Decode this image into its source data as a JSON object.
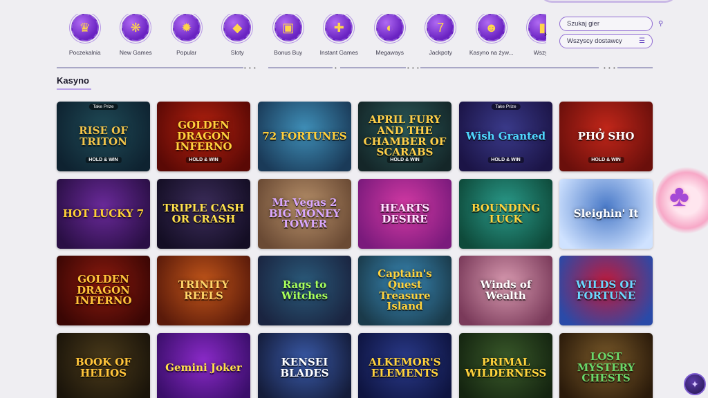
{
  "categories": [
    {
      "label": "Poczekalnia",
      "icon": "crown-icon",
      "glyph": "♛"
    },
    {
      "label": "New Games",
      "icon": "new-games-icon",
      "glyph": "❋"
    },
    {
      "label": "Popular",
      "icon": "flame-icon",
      "glyph": "✹"
    },
    {
      "label": "Sloty",
      "icon": "gem-icon",
      "glyph": "◆"
    },
    {
      "label": "Bonus Buy",
      "icon": "gift-icon",
      "glyph": "▣"
    },
    {
      "label": "Instant Games",
      "icon": "gamepad-icon",
      "glyph": "✚"
    },
    {
      "label": "Megaways",
      "icon": "megaways-icon",
      "glyph": "◐"
    },
    {
      "label": "Jackpoty",
      "icon": "jackpot-777-icon",
      "glyph": "7"
    },
    {
      "label": "Kasyno na żyw...",
      "icon": "live-dealer-icon",
      "glyph": "☻"
    },
    {
      "label": "Wszys",
      "icon": "all-games-icon",
      "glyph": "▮"
    }
  ],
  "search": {
    "placeholder": "Szukaj gier",
    "icon": "search-icon"
  },
  "provider": {
    "label": "Wszyscy dostawcy",
    "icon": "filter-sliders-icon"
  },
  "section": {
    "title": "Kasyno"
  },
  "games": [
    {
      "name": "RISE OF TRITON",
      "sub": "HOLD & WIN",
      "badge": "Take Prize",
      "bg": "#1f4a56",
      "bg2": "#0e2230",
      "color": "#f3c44a"
    },
    {
      "name": "GOLDEN DRAGON INFERNO",
      "sub": "HOLD & WIN",
      "badge": "",
      "bg": "#b3210f",
      "bg2": "#5a0905",
      "color": "#ffd23c"
    },
    {
      "name": "72 FORTUNES",
      "sub": "",
      "badge": "",
      "bg": "#3f8fb8",
      "bg2": "#1a3a58",
      "color": "#ffce3a"
    },
    {
      "name": "APRIL FURY AND THE CHAMBER OF SCARABS",
      "sub": "HOLD & WIN",
      "badge": "",
      "bg": "#2c5a5a",
      "bg2": "#142628",
      "color": "#ffcf48"
    },
    {
      "name": "Wish Granted",
      "sub": "HOLD & WIN",
      "badge": "Take Prize",
      "bg": "#3a3a8a",
      "bg2": "#1b1446",
      "color": "#4fd8ff"
    },
    {
      "name": "PHỞ SHO",
      "sub": "HOLD & WIN",
      "badge": "",
      "bg": "#c2271a",
      "bg2": "#6a0f0b",
      "color": "#ffffff"
    },
    {
      "name": "HOT LUCKY 7",
      "sub": "",
      "badge": "",
      "bg": "#6a2a9a",
      "bg2": "#2a0f45",
      "color": "#ffd236"
    },
    {
      "name": "TRIPLE CASH OR CRASH",
      "sub": "",
      "badge": "",
      "bg": "#3b2c5a",
      "bg2": "#140e24",
      "color": "#ffe14a"
    },
    {
      "name": "Mr Vegas 2 BIG MONEY TOWER",
      "sub": "",
      "badge": "",
      "bg": "#b7906a",
      "bg2": "#6a4a34",
      "color": "#d9a8ff"
    },
    {
      "name": "HEARTS DESIRE",
      "sub": "",
      "badge": "",
      "bg": "#d43aa4",
      "bg2": "#7a1a7c",
      "color": "#ffe3ff"
    },
    {
      "name": "BOUNDING LUCK",
      "sub": "",
      "badge": "",
      "bg": "#2a9a8a",
      "bg2": "#0e4a3a",
      "color": "#ffd23c"
    },
    {
      "name": "Sleighin' It",
      "sub": "",
      "badge": "",
      "bg": "#4a7ac8",
      "bg2": "#cfe2ff",
      "color": "#ffffff"
    },
    {
      "name": "GOLDEN DRAGON INFERNO",
      "sub": "",
      "badge": "",
      "bg": "#8a1a0e",
      "bg2": "#3a0604",
      "color": "#ffc43a"
    },
    {
      "name": "TRINITY REELS",
      "sub": "",
      "badge": "",
      "bg": "#c2561a",
      "bg2": "#5a1a0a",
      "color": "#ffd66a"
    },
    {
      "name": "Rags to Witches",
      "sub": "",
      "badge": "",
      "bg": "#2a5a7a",
      "bg2": "#1a2440",
      "color": "#a8ff5a"
    },
    {
      "name": "Captain's Quest Treasure Island",
      "sub": "",
      "badge": "",
      "bg": "#3a8ab8",
      "bg2": "#1a3a4a",
      "color": "#ffd23c"
    },
    {
      "name": "Winds of Wealth",
      "sub": "",
      "badge": "",
      "bg": "#d89ab0",
      "bg2": "#7a3a5a",
      "color": "#ffffff"
    },
    {
      "name": "WILDS OF FORTUNE",
      "sub": "",
      "badge": "",
      "bg": "#c21a3a",
      "bg2": "#2a4aa8",
      "color": "#6ad8ff"
    },
    {
      "name": "BOOK OF HELIOS",
      "sub": "",
      "badge": "",
      "bg": "#4a3a1a",
      "bg2": "#1a140a",
      "color": "#ffc43a"
    },
    {
      "name": "Gemini Joker",
      "sub": "",
      "badge": "",
      "bg": "#8a2ac8",
      "bg2": "#3a0e6a",
      "color": "#ffe14a"
    },
    {
      "name": "KENSEI BLADES",
      "sub": "",
      "badge": "",
      "bg": "#3a5aa8",
      "bg2": "#141c3a",
      "color": "#ffffff"
    },
    {
      "name": "ALKEMOR'S ELEMENTS",
      "sub": "",
      "badge": "",
      "bg": "#2a3a8a",
      "bg2": "#0e1440",
      "color": "#ffd23c"
    },
    {
      "name": "PRIMAL WILDERNESS",
      "sub": "",
      "badge": "",
      "bg": "#3a5a2a",
      "bg2": "#142410",
      "color": "#ffd23c"
    },
    {
      "name": "LOST MYSTERY CHESTS",
      "sub": "",
      "badge": "",
      "bg": "#7a5a2a",
      "bg2": "#2a1a0a",
      "color": "#6ad86a"
    }
  ],
  "promo": {
    "icon": "club-card-icon",
    "glyph": "♣"
  },
  "chat": {
    "icon": "support-wolf-icon",
    "glyph": "✦"
  }
}
